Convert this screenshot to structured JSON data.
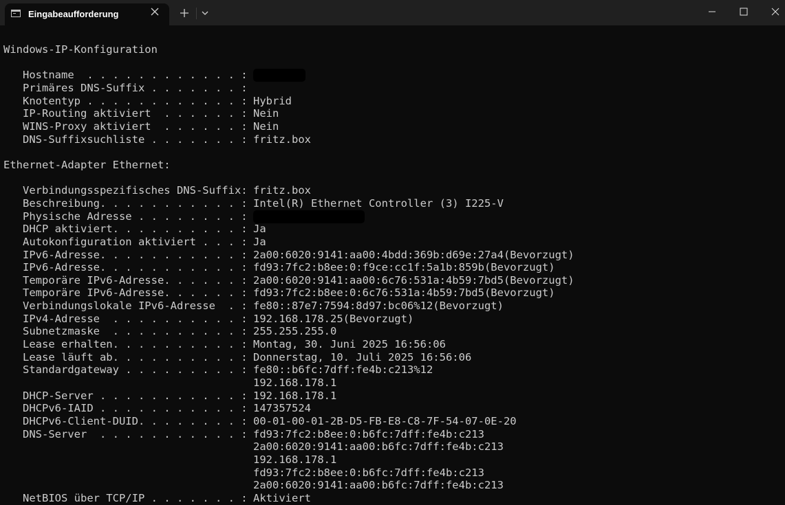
{
  "window": {
    "tab_title": "Eingabeaufforderung",
    "tab_icon": "terminal-icon",
    "new_tab_icon": "plus-icon",
    "dropdown_icon": "chevron-down-icon",
    "minimize_icon": "minimize-icon",
    "maximize_icon": "maximize-icon",
    "close_icon": "close-icon"
  },
  "terminal": {
    "heading": "Windows-IP-Konfiguration",
    "host_lines": [
      {
        "label": "   Hostname  . . . . . . . . . . . . :",
        "value": ""
      },
      {
        "label": "   Primäres DNS-Suffix . . . . . . . :",
        "value": ""
      },
      {
        "label": "   Knotentyp . . . . . . . . . . . . :",
        "value": "Hybrid"
      },
      {
        "label": "   IP-Routing aktiviert  . . . . . . :",
        "value": "Nein"
      },
      {
        "label": "   WINS-Proxy aktiviert  . . . . . . :",
        "value": "Nein"
      },
      {
        "label": "   DNS-Suffixsuchliste . . . . . . . :",
        "value": "fritz.box"
      }
    ],
    "adapter_heading": "Ethernet-Adapter Ethernet:",
    "adapter_lines": [
      {
        "label": "   Verbindungsspezifisches DNS-Suffix:",
        "value": "fritz.box"
      },
      {
        "label": "   Beschreibung. . . . . . . . . . . :",
        "value": "Intel(R) Ethernet Controller (3) I225-V"
      },
      {
        "label": "   Physische Adresse . . . . . . . . :",
        "value": ""
      },
      {
        "label": "   DHCP aktiviert. . . . . . . . . . :",
        "value": "Ja"
      },
      {
        "label": "   Autokonfiguration aktiviert . . . :",
        "value": "Ja"
      },
      {
        "label": "   IPv6-Adresse. . . . . . . . . . . :",
        "value": "2a00:6020:9141:aa00:4bdd:369b:d69e:27a4(Bevorzugt)"
      },
      {
        "label": "   IPv6-Adresse. . . . . . . . . . . :",
        "value": "fd93:7fc2:b8ee:0:f9ce:cc1f:5a1b:859b(Bevorzugt)"
      },
      {
        "label": "   Temporäre IPv6-Adresse. . . . . . :",
        "value": "2a00:6020:9141:aa00:6c76:531a:4b59:7bd5(Bevorzugt)"
      },
      {
        "label": "   Temporäre IPv6-Adresse. . . . . . :",
        "value": "fd93:7fc2:b8ee:0:6c76:531a:4b59:7bd5(Bevorzugt)"
      },
      {
        "label": "   Verbindungslokale IPv6-Adresse  . :",
        "value": "fe80::87e7:7594:8d97:bc06%12(Bevorzugt)"
      },
      {
        "label": "   IPv4-Adresse  . . . . . . . . . . :",
        "value": "192.168.178.25(Bevorzugt)"
      },
      {
        "label": "   Subnetzmaske  . . . . . . . . . . :",
        "value": "255.255.255.0"
      },
      {
        "label": "   Lease erhalten. . . . . . . . . . :",
        "value": "Montag, 30. Juni 2025 16:56:06"
      },
      {
        "label": "   Lease läuft ab. . . . . . . . . . :",
        "value": "Donnerstag, 10. Juli 2025 16:56:06"
      },
      {
        "label": "   Standardgateway . . . . . . . . . :",
        "value": "fe80::b6fc:7dff:fe4b:c213%12"
      },
      {
        "label": "",
        "value": "192.168.178.1"
      },
      {
        "label": "   DHCP-Server . . . . . . . . . . . :",
        "value": "192.168.178.1"
      },
      {
        "label": "   DHCPv6-IAID . . . . . . . . . . . :",
        "value": "147357524"
      },
      {
        "label": "   DHCPv6-Client-DUID. . . . . . . . :",
        "value": "00-01-00-01-2B-D5-FB-E8-C8-7F-54-07-0E-20"
      },
      {
        "label": "   DNS-Server  . . . . . . . . . . . :",
        "value": "fd93:7fc2:b8ee:0:b6fc:7dff:fe4b:c213"
      },
      {
        "label": "",
        "value": "2a00:6020:9141:aa00:b6fc:7dff:fe4b:c213"
      },
      {
        "label": "",
        "value": "192.168.178.1"
      },
      {
        "label": "",
        "value": "fd93:7fc2:b8ee:0:b6fc:7dff:fe4b:c213"
      },
      {
        "label": "",
        "value": "2a00:6020:9141:aa00:b6fc:7dff:fe4b:c213"
      },
      {
        "label": "   NetBIOS über TCP/IP . . . . . . . :",
        "value": "Aktiviert"
      }
    ]
  }
}
